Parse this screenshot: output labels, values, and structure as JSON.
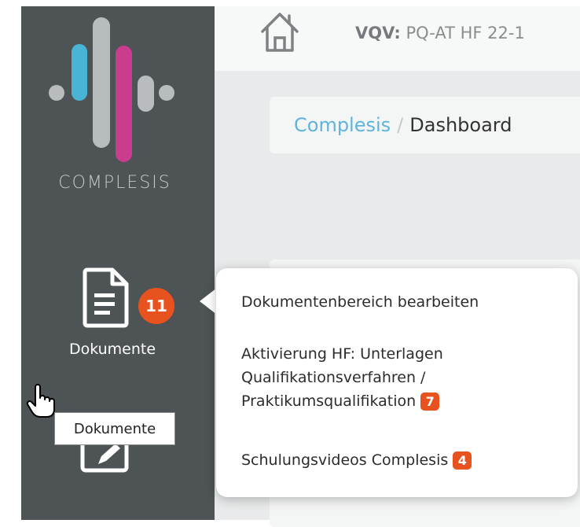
{
  "sidebar": {
    "brand": "COMPLESIS",
    "logo_colors": {
      "gray": "#b8bcbe",
      "blue": "#4ab4d6",
      "pink": "#c93d8c"
    },
    "documents": {
      "label": "Dokumente",
      "badge_count": "11",
      "icon": "document-icon"
    },
    "next_item_icon": "signature-icon"
  },
  "tooltip": {
    "text": "Dokumente"
  },
  "header": {
    "home_icon": "home-icon",
    "project_prefix": "VQV:",
    "project_name": "PQ-AT HF 22-1"
  },
  "breadcrumb": {
    "root": "Complesis",
    "separator": "/",
    "current": "Dashboard"
  },
  "popover_menu": {
    "items": [
      {
        "label": "Dokumentenbereich bearbeiten"
      },
      {
        "line1": "Aktivierung HF: Unterlagen",
        "line2": "Qualifikationsverfahren /",
        "line3": "Praktikumsqualifikation",
        "badge": "7"
      },
      {
        "label": "Schulungsvideos Complesis",
        "badge": "4"
      }
    ]
  },
  "colors": {
    "sidebar_bg": "#4e5355",
    "accent_badge": "#e8521e",
    "link": "#5fb4dd"
  }
}
